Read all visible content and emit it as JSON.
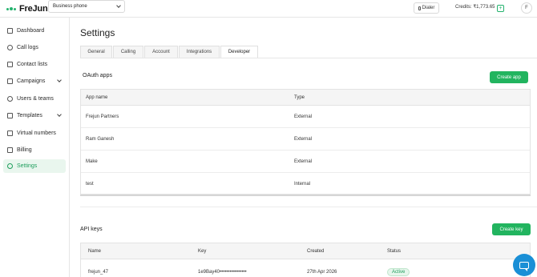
{
  "brand": {
    "name": "FreJun",
    "accent": "#22b45f"
  },
  "topbar": {
    "phone_select": "Business phone",
    "dialer_label": "Dialer",
    "credits_label": "Credits: ₹1,773.65",
    "credits_add": "+",
    "avatar_initial": "F"
  },
  "sidebar": {
    "items": [
      {
        "label": "Dashboard",
        "icon": "chart-icon"
      },
      {
        "label": "Call logs",
        "icon": "clock-icon"
      },
      {
        "label": "Contact lists",
        "icon": "list-icon"
      },
      {
        "label": "Campaigns",
        "icon": "megaphone-icon",
        "expandable": true
      },
      {
        "label": "Users & teams",
        "icon": "users-icon"
      },
      {
        "label": "Templates",
        "icon": "template-icon",
        "expandable": true
      },
      {
        "label": "Virtual numbers",
        "icon": "phone-icon"
      },
      {
        "label": "Billing",
        "icon": "card-icon"
      },
      {
        "label": "Settings",
        "icon": "gear-icon",
        "active": true
      }
    ]
  },
  "page": {
    "title": "Settings",
    "tabs": [
      {
        "label": "General"
      },
      {
        "label": "Calling"
      },
      {
        "label": "Account"
      },
      {
        "label": "Integrations"
      },
      {
        "label": "Developer",
        "active": true
      }
    ]
  },
  "oauth": {
    "title": "OAuth apps",
    "create_label": "Create app",
    "columns": [
      "App name",
      "Type"
    ],
    "rows": [
      {
        "name": "Frejun Partners",
        "type": "External"
      },
      {
        "name": "Ram Ganesh",
        "type": "External"
      },
      {
        "name": "Make",
        "type": "External"
      },
      {
        "name": "test",
        "type": "Internal"
      }
    ]
  },
  "api_keys": {
    "title": "API keys",
    "create_label": "Create key",
    "columns": [
      "Name",
      "Key",
      "Created",
      "Status"
    ],
    "rows": [
      {
        "name": "frejun_47",
        "key": "1e9Bay40••••••••••••••••",
        "created": "27th Apr 2026",
        "status": "Active"
      }
    ]
  },
  "chat": {
    "icon": "chat-icon"
  }
}
